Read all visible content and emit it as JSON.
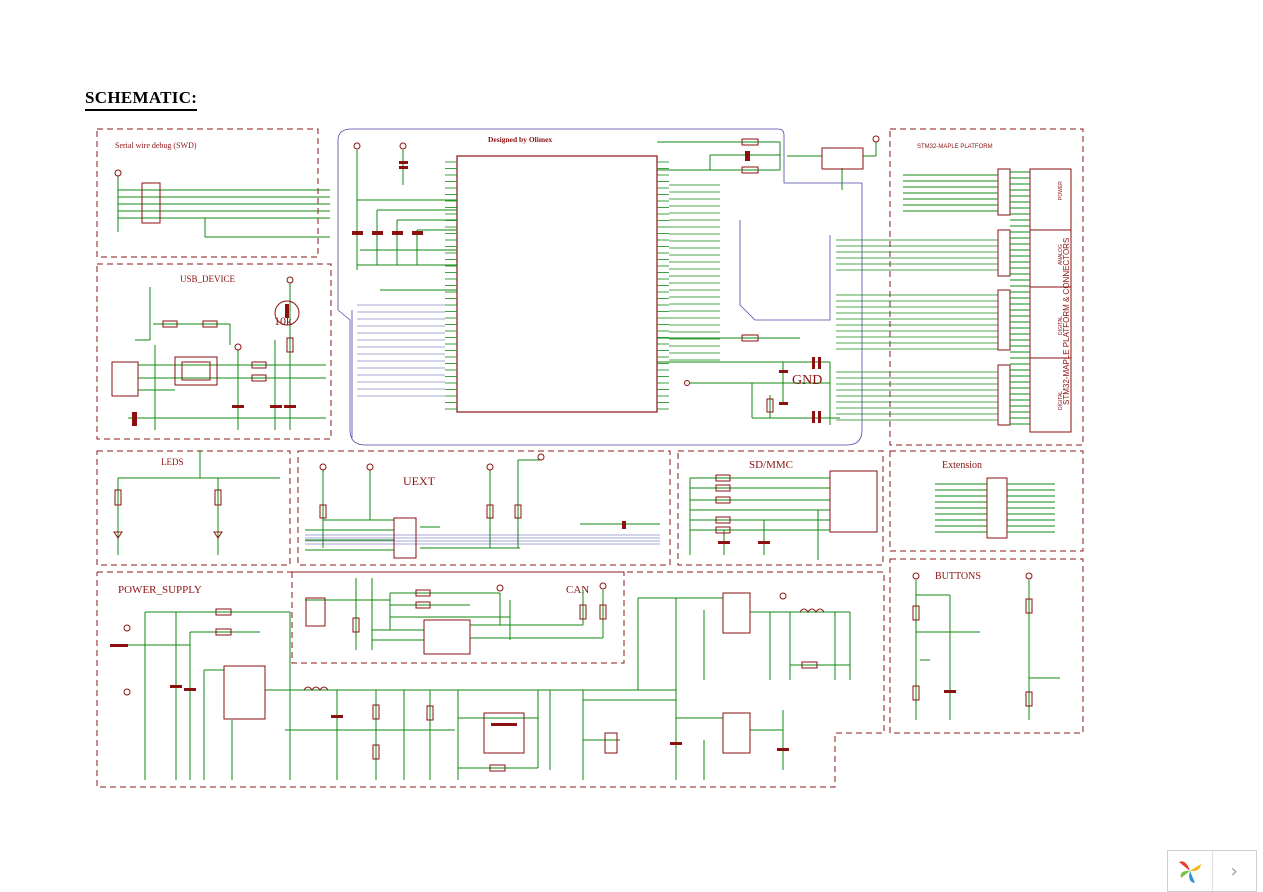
{
  "page": {
    "title": "SCHEMATIC:"
  },
  "blocks": {
    "swd": "Serial wire debug (SWD)",
    "usb": "USB_DEVICE",
    "mcu": "Designed by Olimex",
    "connectors_outer": "STM32-MAPLE PLATFORM",
    "connectors_side": "STM32-MAPLE PLATFORM & CONNECTORS",
    "group_power": "POWER",
    "group_analog": "ANALOG",
    "group_digital_1": "DIGITAL",
    "group_digital_2": "DIGITAL",
    "leds": "LEDS",
    "uext": "UEXT",
    "sdmmc": "SD/MMC",
    "extension": "Extension",
    "power_supply": "POWER_SUPPLY",
    "can": "CAN",
    "buttons": "BUTTONS"
  },
  "parts": {
    "res_usb": "10k",
    "gnd": "GND"
  },
  "icons": {
    "viewer_logo": "pinwheel-logo-icon",
    "next": "chevron-right-icon"
  },
  "colors": {
    "frame": "#8b1a1a",
    "wire": "#118811",
    "bus": "#4a4aa8",
    "component": "#8b1010"
  },
  "viewer": {
    "next_label": "›"
  }
}
